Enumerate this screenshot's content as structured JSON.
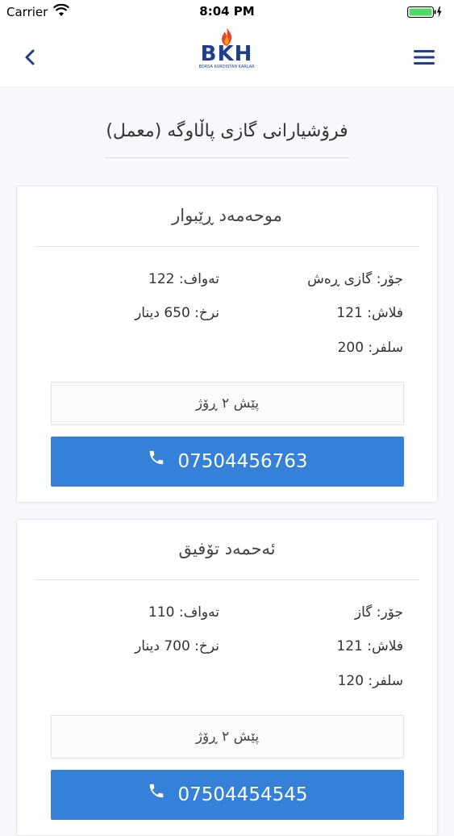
{
  "status_bar": {
    "carrier": "Carrier",
    "time": "8:04 PM"
  },
  "header": {
    "logo_text": "BKH",
    "logo_subtitle": "BORSA KURDISTAN KARLAR"
  },
  "page": {
    "title": "فرۆشیارانی گازی پاڵاوگە (معمل)"
  },
  "sellers": [
    {
      "name": "موحەمەد ڕێبوار",
      "type": "جۆر: گازی ڕەش",
      "tawaf": "تەواف: 122",
      "flash": "فلاش: 121",
      "price": "نرخ: 650 دینار",
      "sulfur": "سلفر: 200",
      "time_ago": "پێش ٢ ڕۆژ",
      "phone": "07504456763"
    },
    {
      "name": "ئەحمەد تۆفیق",
      "type": "جۆر: گاز",
      "tawaf": "تەواف: 110",
      "flash": "فلاش: 121",
      "price": "نرخ: 700 دینار",
      "sulfur": "سلفر: 120",
      "time_ago": "پێش ٢ ڕۆژ",
      "phone": "07504454545"
    }
  ],
  "colors": {
    "accent": "#3580d8",
    "brand": "#1d3f8f"
  },
  "icons": {
    "back": "chevron-left-icon",
    "menu": "hamburger-menu-icon",
    "phone": "phone-icon"
  }
}
